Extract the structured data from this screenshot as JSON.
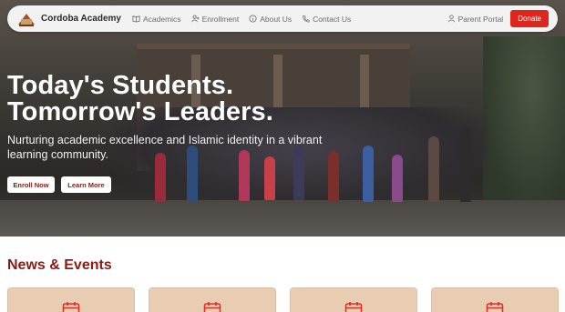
{
  "nav": {
    "brand": "Cordoba Academy",
    "links": [
      {
        "label": "Academics",
        "icon": "book-icon"
      },
      {
        "label": "Enrollment",
        "icon": "user-plus-icon"
      },
      {
        "label": "About Us",
        "icon": "info-icon"
      },
      {
        "label": "Contact Us",
        "icon": "phone-icon"
      }
    ],
    "portal": {
      "label": "Parent Portal",
      "icon": "user-icon"
    },
    "donate_label": "Donate"
  },
  "hero": {
    "title_line1": "Today's Students.",
    "title_line2": "Tomorrow's Leaders.",
    "subtitle": "Nurturing academic excellence and Islamic identity in a vibrant learning community.",
    "primary_cta": "Enroll Now",
    "secondary_cta": "Learn More"
  },
  "news": {
    "title": "News & Events",
    "card_icon": "calendar-icon",
    "card_count": 4
  },
  "colors": {
    "accent": "#8b1a12",
    "donate": "#e0261c",
    "card_bg": "#e9cdb3",
    "card_icon": "#d9302a"
  }
}
